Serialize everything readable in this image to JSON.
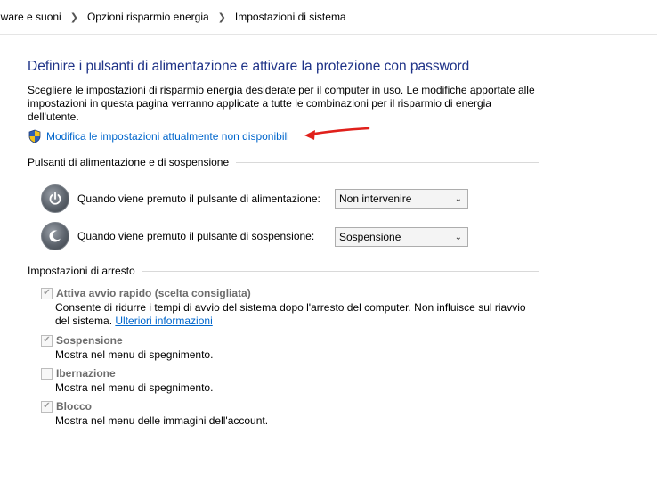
{
  "breadcrumb": {
    "items": [
      "lware e suoni",
      "Opzioni risparmio energia",
      "Impostazioni di sistema"
    ]
  },
  "main": {
    "title": "Definire i pulsanti di alimentazione e attivare la protezione con password",
    "description": "Scegliere le impostazioni di risparmio energia desiderate per il computer in uso. Le modifiche apportate alle impostazioni in questa pagina verranno applicate a tutte le combinazioni per il risparmio di energia dell'utente.",
    "change_link": "Modifica le impostazioni attualmente non disponibili"
  },
  "power_buttons": {
    "header": "Pulsanti di alimentazione e di sospensione",
    "power_label": "Quando viene premuto il pulsante di alimentazione:",
    "power_value": "Non intervenire",
    "sleep_label": "Quando viene premuto il pulsante di sospensione:",
    "sleep_value": "Sospensione"
  },
  "shutdown": {
    "header": "Impostazioni di arresto",
    "fast_startup": {
      "label": "Attiva avvio rapido (scelta consigliata)",
      "checked": true,
      "desc_line1": "Consente di ridurre i tempi di avvio del sistema dopo l'arresto del computer. Non influisce sul riavvio",
      "desc_line2": "del sistema.",
      "more_info": "Ulteriori informazioni"
    },
    "sleep": {
      "label": "Sospensione",
      "checked": true,
      "desc": "Mostra nel menu di spegnimento."
    },
    "hibernate": {
      "label": "Ibernazione",
      "checked": false,
      "desc": "Mostra nel menu di spegnimento."
    },
    "lock": {
      "label": "Blocco",
      "checked": true,
      "desc": "Mostra nel menu delle immagini dell'account."
    }
  },
  "colors": {
    "title": "#1e3287",
    "link": "#0066cc",
    "arrow": "#e0201b"
  }
}
